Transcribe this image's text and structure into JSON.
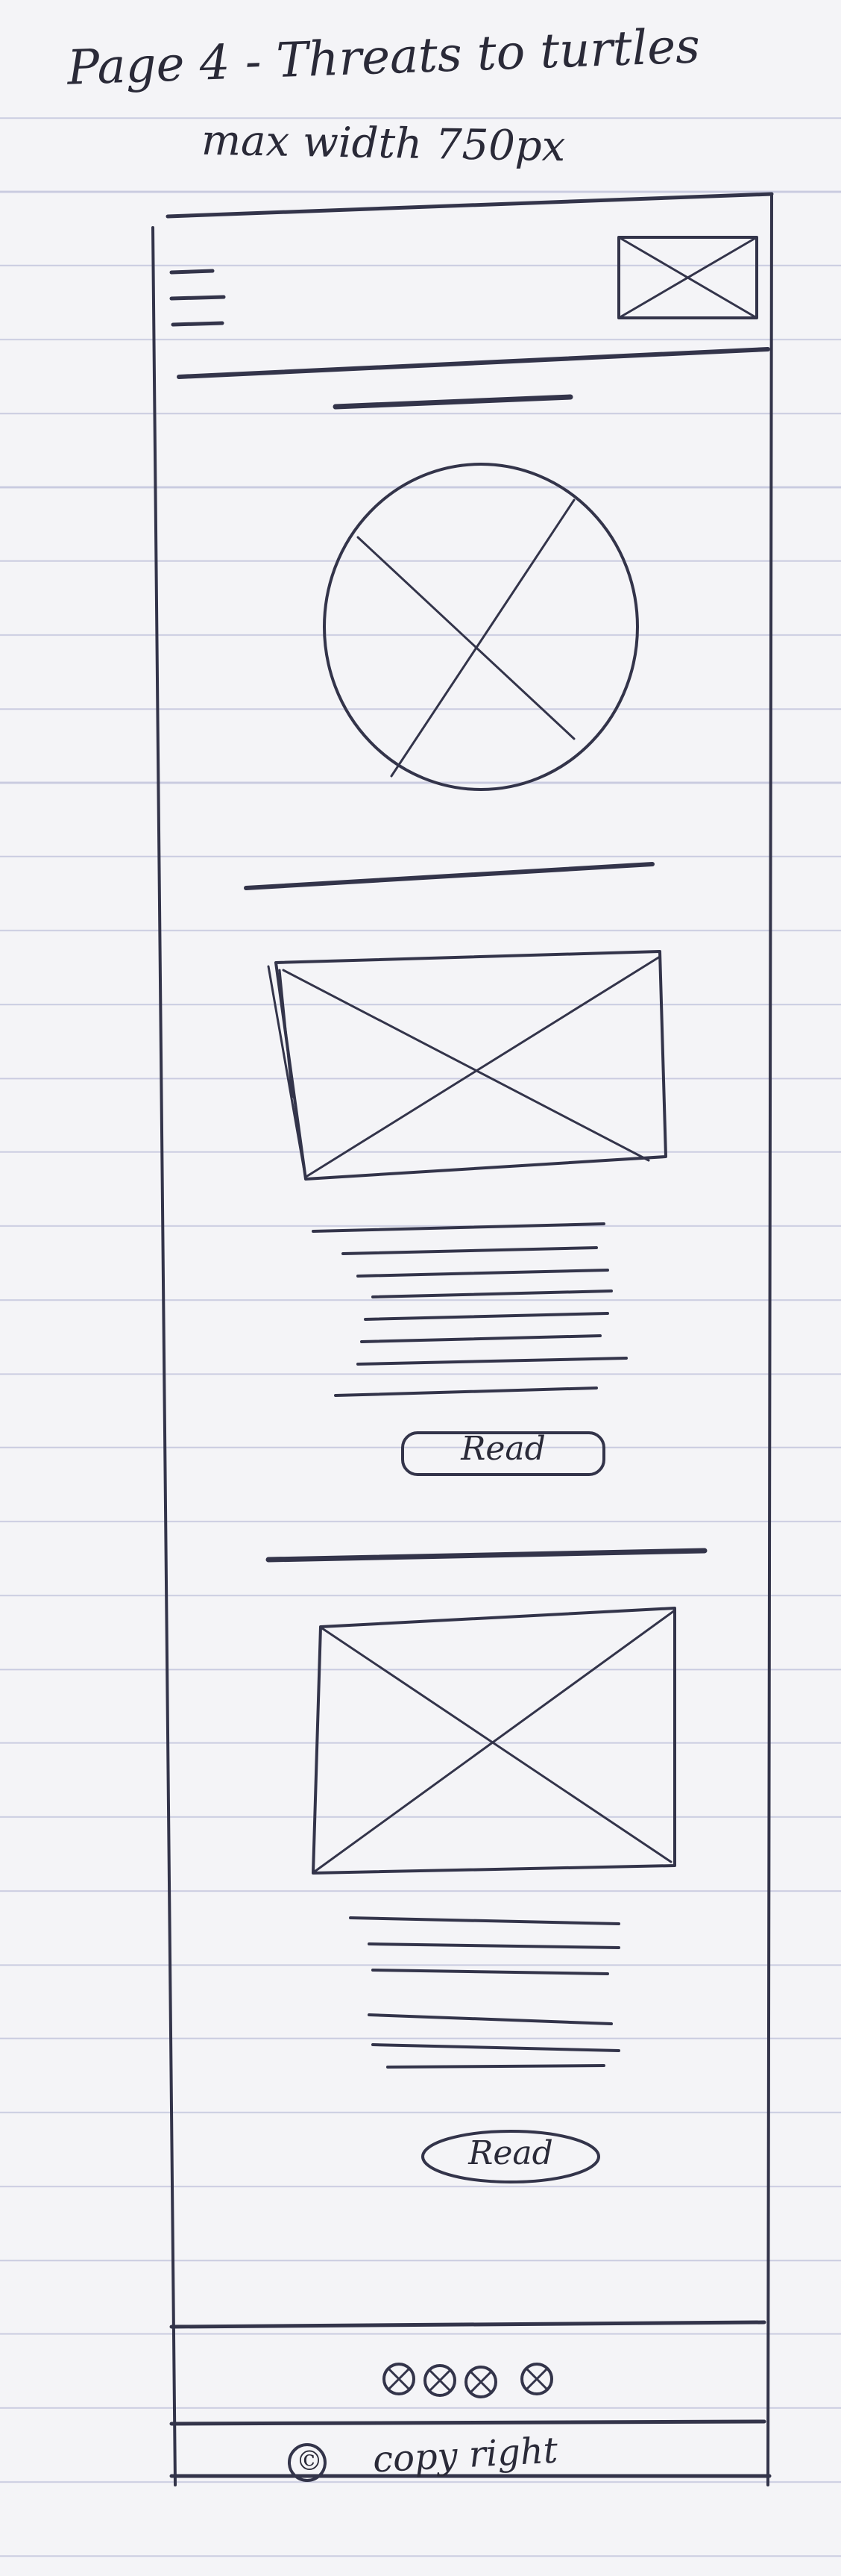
{
  "page_note": {
    "line1": "Page 4 - Threats to turtles",
    "line2": "max width 750px"
  },
  "header": {
    "menu_icon": "hamburger-menu-icon",
    "logo_icon": "image-placeholder-icon"
  },
  "sections": [
    {
      "heading_placeholder": "heading-scribble",
      "image_icon": "circle-image-placeholder-icon"
    },
    {
      "heading_placeholder": "heading-scribble",
      "image_icon": "image-placeholder-icon",
      "button_label": "Read"
    },
    {
      "heading_placeholder": "heading-scribble",
      "image_icon": "image-placeholder-icon",
      "button_label": "Read"
    }
  ],
  "footer": {
    "social_icons": [
      "social-icon",
      "social-icon",
      "social-icon",
      "social-icon"
    ],
    "copyright_symbol": "©",
    "copyright_text": "copy right"
  }
}
